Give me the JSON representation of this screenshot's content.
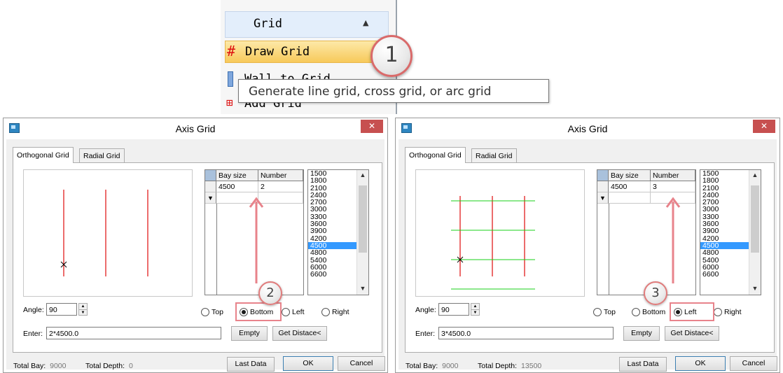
{
  "menu": {
    "header": "Grid",
    "items": [
      {
        "label": "Draw Grid",
        "icon": "grid-icon"
      },
      {
        "label": "Wall to Grid",
        "icon": "wall-grid-icon"
      },
      {
        "label": "Add Grid",
        "icon": "add-grid-icon"
      }
    ],
    "callout": "1",
    "tooltip": "Generate line grid, cross grid, or arc grid"
  },
  "dialogs": [
    {
      "title": "Axis Grid",
      "close": "✕",
      "tabs": [
        "Orthogonal Grid",
        "Radial Grid"
      ],
      "table": {
        "headers": [
          "Bay size",
          "Number"
        ],
        "rows": [
          [
            "4500",
            "2"
          ]
        ]
      },
      "sizes": [
        "1500",
        "1800",
        "2100",
        "2400",
        "2700",
        "3000",
        "3300",
        "3600",
        "3900",
        "4200",
        "4500",
        "4800",
        "5400",
        "6000",
        "6600"
      ],
      "selected_size": "4500",
      "angle_label": "Angle:",
      "angle": "90",
      "enter_label": "Enter:",
      "enter": "2*4500.0",
      "radios": [
        "Top",
        "Bottom",
        "Left",
        "Right"
      ],
      "selected_radio": "Bottom",
      "empty": "Empty",
      "get_distance": "Get Distace<",
      "total_bay_label": "Total Bay:",
      "total_bay": "9000",
      "total_depth_label": "Total Depth:",
      "total_depth": "0",
      "last_data": "Last Data",
      "ok": "OK",
      "cancel": "Cancel",
      "callout": "2"
    },
    {
      "title": "Axis Grid",
      "close": "✕",
      "tabs": [
        "Orthogonal Grid",
        "Radial Grid"
      ],
      "table": {
        "headers": [
          "Bay size",
          "Number"
        ],
        "rows": [
          [
            "4500",
            "3"
          ]
        ]
      },
      "sizes": [
        "1500",
        "1800",
        "2100",
        "2400",
        "2700",
        "3000",
        "3300",
        "3600",
        "3900",
        "4200",
        "4500",
        "4800",
        "5400",
        "6000",
        "6600"
      ],
      "selected_size": "4500",
      "angle_label": "Angle:",
      "angle": "90",
      "enter_label": "Enter:",
      "enter": "3*4500.0",
      "radios": [
        "Top",
        "Bottom",
        "Left",
        "Right"
      ],
      "selected_radio": "Left",
      "empty": "Empty",
      "get_distance": "Get Distace<",
      "total_bay_label": "Total Bay:",
      "total_bay": "9000",
      "total_depth_label": "Total Depth:",
      "total_depth": "13500",
      "last_data": "Last Data",
      "ok": "OK",
      "cancel": "Cancel",
      "callout": "3"
    }
  ],
  "colors": {
    "axis_line": "#e21d1d",
    "cross_line": "#18d218",
    "highlight": "#e8838b",
    "selection": "#3399ff"
  }
}
